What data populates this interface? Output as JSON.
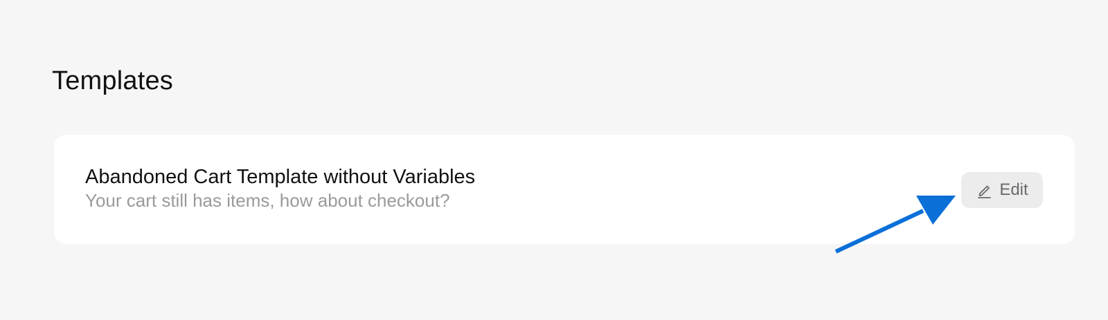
{
  "section": {
    "title": "Templates"
  },
  "templates": [
    {
      "name": "Abandoned Cart Template without Variables",
      "preview": "Your cart still has items, how about checkout?",
      "edit_label": "Edit",
      "edit_icon": "pencil-icon"
    }
  ],
  "colors": {
    "background": "#f6f6f6",
    "card": "#ffffff",
    "edit_button_bg": "#ececec",
    "preview_text": "#9a9a9a",
    "annotation_arrow": "#0b6fd8"
  }
}
